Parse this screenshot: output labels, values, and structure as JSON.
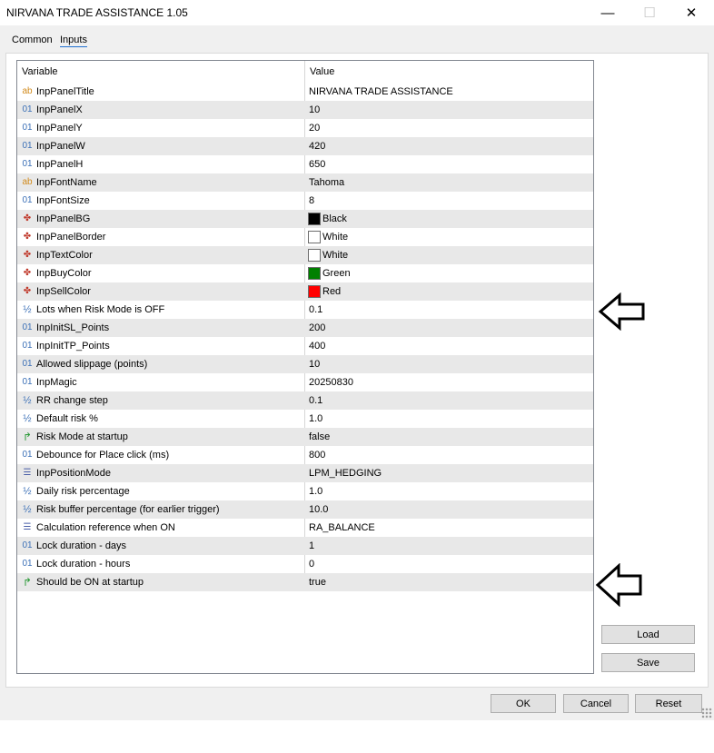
{
  "window": {
    "title": "NIRVANA TRADE ASSISTANCE 1.05",
    "minimize": "—",
    "maximize": "☐",
    "close": "✕"
  },
  "tabs": [
    "Common",
    "Inputs"
  ],
  "table": {
    "headers": [
      "Variable",
      "Value"
    ],
    "rows": [
      {
        "icon": "ab",
        "name": "InpPanelTitle",
        "value": "NIRVANA TRADE ASSISTANCE"
      },
      {
        "icon": "01",
        "name": "InpPanelX",
        "value": "10"
      },
      {
        "icon": "01",
        "name": "InpPanelY",
        "value": "20"
      },
      {
        "icon": "01",
        "name": "InpPanelW",
        "value": "420"
      },
      {
        "icon": "01",
        "name": "InpPanelH",
        "value": "650"
      },
      {
        "icon": "ab",
        "name": "InpFontName",
        "value": "Tahoma"
      },
      {
        "icon": "01",
        "name": "InpFontSize",
        "value": "8"
      },
      {
        "icon": "color",
        "name": "InpPanelBG",
        "value": "Black",
        "swatch": "#000000"
      },
      {
        "icon": "color",
        "name": "InpPanelBorder",
        "value": "White",
        "swatch": "#ffffff"
      },
      {
        "icon": "color",
        "name": "InpTextColor",
        "value": "White",
        "swatch": "#ffffff"
      },
      {
        "icon": "color",
        "name": "InpBuyColor",
        "value": "Green",
        "swatch": "#008000"
      },
      {
        "icon": "color",
        "name": "InpSellColor",
        "value": "Red",
        "swatch": "#ff0000"
      },
      {
        "icon": "half",
        "name": "Lots when Risk Mode is OFF",
        "value": "0.1"
      },
      {
        "icon": "01",
        "name": "InpInitSL_Points",
        "value": "200"
      },
      {
        "icon": "01",
        "name": "InpInitTP_Points",
        "value": "400"
      },
      {
        "icon": "01",
        "name": "Allowed slippage (points)",
        "value": "10"
      },
      {
        "icon": "01",
        "name": "InpMagic",
        "value": "20250830"
      },
      {
        "icon": "half",
        "name": "RR change step",
        "value": "0.1"
      },
      {
        "icon": "half",
        "name": "Default risk %",
        "value": "1.0"
      },
      {
        "icon": "bool",
        "name": "Risk Mode at startup",
        "value": "false"
      },
      {
        "icon": "01",
        "name": "Debounce for Place click (ms)",
        "value": "800"
      },
      {
        "icon": "enum",
        "name": "InpPositionMode",
        "value": "LPM_HEDGING"
      },
      {
        "icon": "half",
        "name": "Daily risk percentage",
        "value": "1.0"
      },
      {
        "icon": "half",
        "name": "Risk buffer percentage (for earlier trigger)",
        "value": "10.0"
      },
      {
        "icon": "enum",
        "name": "Calculation reference when ON",
        "value": "RA_BALANCE"
      },
      {
        "icon": "01",
        "name": "Lock duration - days",
        "value": "1"
      },
      {
        "icon": "01",
        "name": "Lock duration - hours",
        "value": "0"
      },
      {
        "icon": "bool",
        "name": "Should be ON at startup",
        "value": "true"
      }
    ]
  },
  "side_buttons": {
    "load": "Load",
    "save": "Save"
  },
  "footer_buttons": {
    "ok": "OK",
    "cancel": "Cancel",
    "reset": "Reset"
  },
  "colors": {
    "accent": "#1f6fd0",
    "row_alt": "#e8e8e8"
  }
}
